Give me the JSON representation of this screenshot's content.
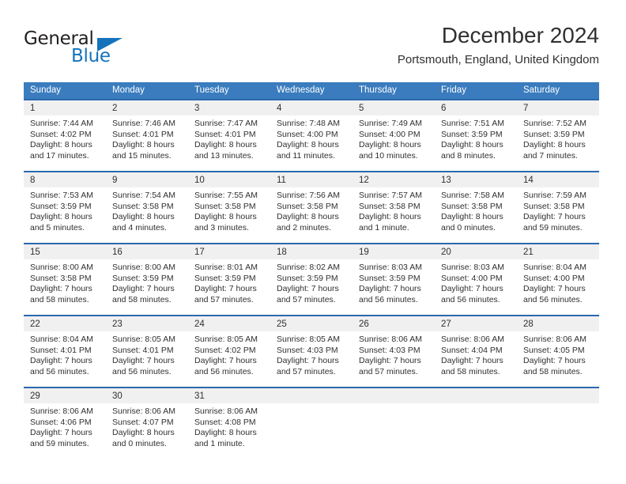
{
  "brand": {
    "name_part1": "General",
    "name_part2": "Blue",
    "accent_color": "#1573bb",
    "triangle_icon": "triangle-icon"
  },
  "header": {
    "title": "December 2024",
    "subtitle": "Portsmouth, England, United Kingdom"
  },
  "theme": {
    "header_bar_color": "#3a7cbe",
    "week_divider_color": "#2a69ae",
    "day_band_color": "#f0f0f0",
    "text_color": "#303030"
  },
  "calendar": {
    "weekdays": [
      "Sunday",
      "Monday",
      "Tuesday",
      "Wednesday",
      "Thursday",
      "Friday",
      "Saturday"
    ],
    "weeks": [
      [
        {
          "day": "1",
          "sunrise": "Sunrise: 7:44 AM",
          "sunset": "Sunset: 4:02 PM",
          "daylight_1": "Daylight: 8 hours",
          "daylight_2": "and 17 minutes."
        },
        {
          "day": "2",
          "sunrise": "Sunrise: 7:46 AM",
          "sunset": "Sunset: 4:01 PM",
          "daylight_1": "Daylight: 8 hours",
          "daylight_2": "and 15 minutes."
        },
        {
          "day": "3",
          "sunrise": "Sunrise: 7:47 AM",
          "sunset": "Sunset: 4:01 PM",
          "daylight_1": "Daylight: 8 hours",
          "daylight_2": "and 13 minutes."
        },
        {
          "day": "4",
          "sunrise": "Sunrise: 7:48 AM",
          "sunset": "Sunset: 4:00 PM",
          "daylight_1": "Daylight: 8 hours",
          "daylight_2": "and 11 minutes."
        },
        {
          "day": "5",
          "sunrise": "Sunrise: 7:49 AM",
          "sunset": "Sunset: 4:00 PM",
          "daylight_1": "Daylight: 8 hours",
          "daylight_2": "and 10 minutes."
        },
        {
          "day": "6",
          "sunrise": "Sunrise: 7:51 AM",
          "sunset": "Sunset: 3:59 PM",
          "daylight_1": "Daylight: 8 hours",
          "daylight_2": "and 8 minutes."
        },
        {
          "day": "7",
          "sunrise": "Sunrise: 7:52 AM",
          "sunset": "Sunset: 3:59 PM",
          "daylight_1": "Daylight: 8 hours",
          "daylight_2": "and 7 minutes."
        }
      ],
      [
        {
          "day": "8",
          "sunrise": "Sunrise: 7:53 AM",
          "sunset": "Sunset: 3:59 PM",
          "daylight_1": "Daylight: 8 hours",
          "daylight_2": "and 5 minutes."
        },
        {
          "day": "9",
          "sunrise": "Sunrise: 7:54 AM",
          "sunset": "Sunset: 3:58 PM",
          "daylight_1": "Daylight: 8 hours",
          "daylight_2": "and 4 minutes."
        },
        {
          "day": "10",
          "sunrise": "Sunrise: 7:55 AM",
          "sunset": "Sunset: 3:58 PM",
          "daylight_1": "Daylight: 8 hours",
          "daylight_2": "and 3 minutes."
        },
        {
          "day": "11",
          "sunrise": "Sunrise: 7:56 AM",
          "sunset": "Sunset: 3:58 PM",
          "daylight_1": "Daylight: 8 hours",
          "daylight_2": "and 2 minutes."
        },
        {
          "day": "12",
          "sunrise": "Sunrise: 7:57 AM",
          "sunset": "Sunset: 3:58 PM",
          "daylight_1": "Daylight: 8 hours",
          "daylight_2": "and 1 minute."
        },
        {
          "day": "13",
          "sunrise": "Sunrise: 7:58 AM",
          "sunset": "Sunset: 3:58 PM",
          "daylight_1": "Daylight: 8 hours",
          "daylight_2": "and 0 minutes."
        },
        {
          "day": "14",
          "sunrise": "Sunrise: 7:59 AM",
          "sunset": "Sunset: 3:58 PM",
          "daylight_1": "Daylight: 7 hours",
          "daylight_2": "and 59 minutes."
        }
      ],
      [
        {
          "day": "15",
          "sunrise": "Sunrise: 8:00 AM",
          "sunset": "Sunset: 3:58 PM",
          "daylight_1": "Daylight: 7 hours",
          "daylight_2": "and 58 minutes."
        },
        {
          "day": "16",
          "sunrise": "Sunrise: 8:00 AM",
          "sunset": "Sunset: 3:59 PM",
          "daylight_1": "Daylight: 7 hours",
          "daylight_2": "and 58 minutes."
        },
        {
          "day": "17",
          "sunrise": "Sunrise: 8:01 AM",
          "sunset": "Sunset: 3:59 PM",
          "daylight_1": "Daylight: 7 hours",
          "daylight_2": "and 57 minutes."
        },
        {
          "day": "18",
          "sunrise": "Sunrise: 8:02 AM",
          "sunset": "Sunset: 3:59 PM",
          "daylight_1": "Daylight: 7 hours",
          "daylight_2": "and 57 minutes."
        },
        {
          "day": "19",
          "sunrise": "Sunrise: 8:03 AM",
          "sunset": "Sunset: 3:59 PM",
          "daylight_1": "Daylight: 7 hours",
          "daylight_2": "and 56 minutes."
        },
        {
          "day": "20",
          "sunrise": "Sunrise: 8:03 AM",
          "sunset": "Sunset: 4:00 PM",
          "daylight_1": "Daylight: 7 hours",
          "daylight_2": "and 56 minutes."
        },
        {
          "day": "21",
          "sunrise": "Sunrise: 8:04 AM",
          "sunset": "Sunset: 4:00 PM",
          "daylight_1": "Daylight: 7 hours",
          "daylight_2": "and 56 minutes."
        }
      ],
      [
        {
          "day": "22",
          "sunrise": "Sunrise: 8:04 AM",
          "sunset": "Sunset: 4:01 PM",
          "daylight_1": "Daylight: 7 hours",
          "daylight_2": "and 56 minutes."
        },
        {
          "day": "23",
          "sunrise": "Sunrise: 8:05 AM",
          "sunset": "Sunset: 4:01 PM",
          "daylight_1": "Daylight: 7 hours",
          "daylight_2": "and 56 minutes."
        },
        {
          "day": "24",
          "sunrise": "Sunrise: 8:05 AM",
          "sunset": "Sunset: 4:02 PM",
          "daylight_1": "Daylight: 7 hours",
          "daylight_2": "and 56 minutes."
        },
        {
          "day": "25",
          "sunrise": "Sunrise: 8:05 AM",
          "sunset": "Sunset: 4:03 PM",
          "daylight_1": "Daylight: 7 hours",
          "daylight_2": "and 57 minutes."
        },
        {
          "day": "26",
          "sunrise": "Sunrise: 8:06 AM",
          "sunset": "Sunset: 4:03 PM",
          "daylight_1": "Daylight: 7 hours",
          "daylight_2": "and 57 minutes."
        },
        {
          "day": "27",
          "sunrise": "Sunrise: 8:06 AM",
          "sunset": "Sunset: 4:04 PM",
          "daylight_1": "Daylight: 7 hours",
          "daylight_2": "and 58 minutes."
        },
        {
          "day": "28",
          "sunrise": "Sunrise: 8:06 AM",
          "sunset": "Sunset: 4:05 PM",
          "daylight_1": "Daylight: 7 hours",
          "daylight_2": "and 58 minutes."
        }
      ],
      [
        {
          "day": "29",
          "sunrise": "Sunrise: 8:06 AM",
          "sunset": "Sunset: 4:06 PM",
          "daylight_1": "Daylight: 7 hours",
          "daylight_2": "and 59 minutes."
        },
        {
          "day": "30",
          "sunrise": "Sunrise: 8:06 AM",
          "sunset": "Sunset: 4:07 PM",
          "daylight_1": "Daylight: 8 hours",
          "daylight_2": "and 0 minutes."
        },
        {
          "day": "31",
          "sunrise": "Sunrise: 8:06 AM",
          "sunset": "Sunset: 4:08 PM",
          "daylight_1": "Daylight: 8 hours",
          "daylight_2": "and 1 minute."
        },
        {
          "day": "",
          "sunrise": "",
          "sunset": "",
          "daylight_1": "",
          "daylight_2": ""
        },
        {
          "day": "",
          "sunrise": "",
          "sunset": "",
          "daylight_1": "",
          "daylight_2": ""
        },
        {
          "day": "",
          "sunrise": "",
          "sunset": "",
          "daylight_1": "",
          "daylight_2": ""
        },
        {
          "day": "",
          "sunrise": "",
          "sunset": "",
          "daylight_1": "",
          "daylight_2": ""
        }
      ]
    ]
  }
}
